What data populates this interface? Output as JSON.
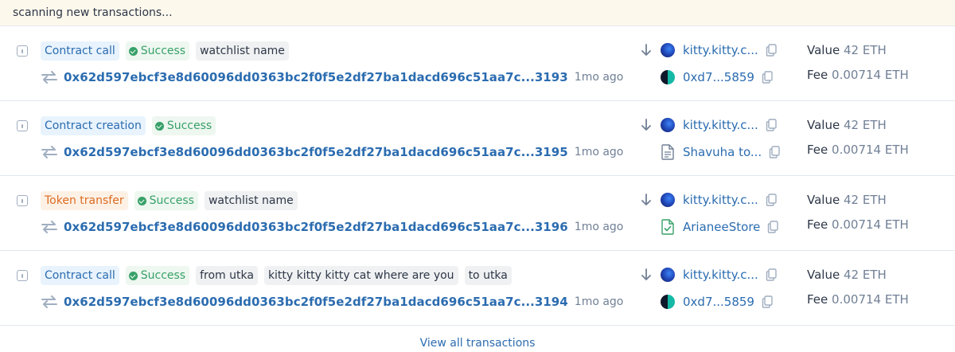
{
  "banner": {
    "text": "scanning new transactions..."
  },
  "transactions": [
    {
      "type_label": "Contract call",
      "type_color": "blue",
      "status_label": "Success",
      "tags": [
        "watchlist name"
      ],
      "hash": "0x62d597ebcf3e8d60096dd0363bc2f0f5e2df27ba1dacd696c51aa7c...3193",
      "age": "1mo ago",
      "from": {
        "label": "kitty.kitty.c...",
        "icon": "kitty-avatar-icon"
      },
      "to": {
        "label": "0xd7...5859",
        "icon": "address-avatar-icon"
      },
      "value_label": "Value",
      "value": "42 ETH",
      "fee_label": "Fee",
      "fee": "0.00714 ETH"
    },
    {
      "type_label": "Contract creation",
      "type_color": "blue",
      "status_label": "Success",
      "tags": [],
      "hash": "0x62d597ebcf3e8d60096dd0363bc2f0f5e2df27ba1dacd696c51aa7c...3195",
      "age": "1mo ago",
      "from": {
        "label": "kitty.kitty.c...",
        "icon": "kitty-avatar-icon"
      },
      "to": {
        "label": "Shavuha to...",
        "icon": "document-icon"
      },
      "value_label": "Value",
      "value": "42 ETH",
      "fee_label": "Fee",
      "fee": "0.00714 ETH"
    },
    {
      "type_label": "Token transfer",
      "type_color": "orange",
      "status_label": "Success",
      "tags": [
        "watchlist name"
      ],
      "hash": "0x62d597ebcf3e8d60096dd0363bc2f0f5e2df27ba1dacd696c51aa7c...3196",
      "age": "1mo ago",
      "from": {
        "label": "kitty.kitty.c...",
        "icon": "kitty-avatar-icon"
      },
      "to": {
        "label": "ArianeeStore",
        "icon": "verified-contract-icon"
      },
      "value_label": "Value",
      "value": "42 ETH",
      "fee_label": "Fee",
      "fee": "0.00714 ETH"
    },
    {
      "type_label": "Contract call",
      "type_color": "blue",
      "status_label": "Success",
      "tags": [
        "from utka",
        "kitty kitty kitty cat where are you",
        "to utka"
      ],
      "hash": "0x62d597ebcf3e8d60096dd0363bc2f0f5e2df27ba1dacd696c51aa7c...3194",
      "age": "1mo ago",
      "from": {
        "label": "kitty.kitty.c...",
        "icon": "kitty-avatar-icon"
      },
      "to": {
        "label": "0xd7...5859",
        "icon": "address-avatar-icon"
      },
      "value_label": "Value",
      "value": "42 ETH",
      "fee_label": "Fee",
      "fee": "0.00714 ETH"
    }
  ],
  "footer": {
    "link": "View all transactions"
  },
  "colors": {
    "link": "#2b6cb0",
    "success": "#38a169",
    "token_transfer": "#dd6b20",
    "banner_bg": "#fdf8ec"
  }
}
